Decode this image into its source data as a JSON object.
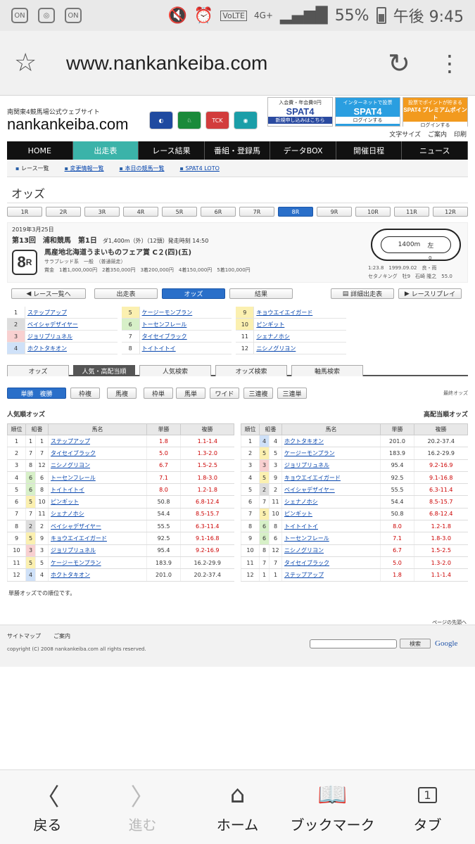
{
  "status": {
    "carrier_icons": [
      "ON",
      "ON"
    ],
    "network": "4G+",
    "battery": "55%",
    "time": "午後 9:45",
    "volte": "VoLTE"
  },
  "browser": {
    "url": "www.nankankeiba.com"
  },
  "site": {
    "subtitle": "南関東4競馬場公式ウェブサイト",
    "logo": "nankankeiba.com",
    "spat_banners": [
      {
        "top": "入会費・年会費0円",
        "big": "SPAT4",
        "foot": "新規申し込みはこちら"
      },
      {
        "top": "インターネットで投票",
        "big": "SPAT4",
        "foot": "ログインする"
      },
      {
        "top": "投票でポイントが貯まる",
        "big": "SPAT4 プレミアムポイント",
        "foot": "ログインする"
      }
    ],
    "utility": [
      "文字サイズ",
      "ご案内",
      "印刷"
    ],
    "nav": [
      "HOME",
      "出走表",
      "レース結果",
      "番組・登録馬",
      "データBOX",
      "開催日程",
      "ニュース"
    ],
    "subnav": [
      "レース一覧",
      "変更情報一覧",
      "本日の競馬一覧",
      "SPAT4 LOTO"
    ]
  },
  "page_title": "オッズ",
  "races": [
    "1R",
    "2R",
    "3R",
    "4R",
    "5R",
    "6R",
    "7R",
    "8R",
    "9R",
    "10R",
    "11R",
    "12R"
  ],
  "race": {
    "date": "2019年3月25日",
    "meeting": "第13回　浦和競馬　第1日",
    "course": "ダ1,400m（外）（12頭）発走時刻 14:50",
    "number": "8",
    "suffix": "R",
    "name": "馬産地北海道うまいものフェア賞 C２(四)(五)",
    "conditions": "サラブレッド系　一般　（普通競走）",
    "prize": "賞金　1着1,000,000円　2着350,000円　3着200,000円　4着150,000円　5着100,000円",
    "track_label": "1400m",
    "track_dir": "左",
    "track_zero": "0",
    "record_line1": "1:23.8　1999.09.02　良・雨",
    "record_line2": "セタノキング　牡9　石崎 隆之　55.0"
  },
  "pills": [
    "レース一覧へ",
    "出走表",
    "オッズ",
    "結果",
    "詳細出走表",
    "レースリプレイ"
  ],
  "entries": [
    {
      "n": "1",
      "name": "ステップアップ"
    },
    {
      "n": "2",
      "name": "ベイシャデザイヤー"
    },
    {
      "n": "3",
      "name": "ジョリプリュネル"
    },
    {
      "n": "4",
      "name": "ホクトタキオン"
    },
    {
      "n": "5",
      "name": "ケージーモンプラン"
    },
    {
      "n": "6",
      "name": "トーセンフレール"
    },
    {
      "n": "7",
      "name": "タイセイブラック"
    },
    {
      "n": "8",
      "name": "トイトイトイ"
    },
    {
      "n": "9",
      "name": "キョウエイエイガード"
    },
    {
      "n": "10",
      "name": "ピンギット"
    },
    {
      "n": "11",
      "name": "シェナノホシ"
    },
    {
      "n": "12",
      "name": "ニシノグリヨン"
    }
  ],
  "tabs": [
    "オッズ",
    "人気・高配当順",
    "人気検索",
    "オッズ検索",
    "軸馬検索"
  ],
  "bet_types": [
    "単勝　複勝",
    "枠複",
    "馬複",
    "枠単",
    "馬単",
    "ワイド",
    "三連複",
    "三連単"
  ],
  "latest_label": "最終オッズ",
  "left_title": "人気順オッズ",
  "right_title": "高配当順オッズ",
  "table_headers": [
    "順位",
    "組番",
    "馬名",
    "単勝",
    "複勝"
  ],
  "popular": [
    {
      "rank": "1",
      "waku": "1",
      "no": "1",
      "name": "ステップアップ",
      "win": "1.8",
      "place": "1.1-1.4"
    },
    {
      "rank": "2",
      "waku": "7",
      "no": "7",
      "name": "タイセイブラック",
      "win": "5.0",
      "place": "1.3-2.0"
    },
    {
      "rank": "3",
      "waku": "8",
      "no": "12",
      "name": "ニシノグリヨン",
      "win": "6.7",
      "place": "1.5-2.5"
    },
    {
      "rank": "4",
      "waku": "6",
      "no": "6",
      "name": "トーセンフレール",
      "win": "7.1",
      "place": "1.8-3.0"
    },
    {
      "rank": "5",
      "waku": "6",
      "no": "8",
      "name": "トイトイトイ",
      "win": "8.0",
      "place": "1.2-1.8"
    },
    {
      "rank": "6",
      "waku": "5",
      "no": "10",
      "name": "ピンギット",
      "win": "50.8",
      "place": "6.8-12.4"
    },
    {
      "rank": "7",
      "waku": "7",
      "no": "11",
      "name": "シェナノホシ",
      "win": "54.4",
      "place": "8.5-15.7"
    },
    {
      "rank": "8",
      "waku": "2",
      "no": "2",
      "name": "ベイシャデザイヤー",
      "win": "55.5",
      "place": "6.3-11.4"
    },
    {
      "rank": "9",
      "waku": "5",
      "no": "9",
      "name": "キョウエイエイガード",
      "win": "92.5",
      "place": "9.1-16.8"
    },
    {
      "rank": "10",
      "waku": "3",
      "no": "3",
      "name": "ジョリプリュネル",
      "win": "95.4",
      "place": "9.2-16.9"
    },
    {
      "rank": "11",
      "waku": "5",
      "no": "5",
      "name": "ケージーモンプラン",
      "win": "183.9",
      "place": "16.2-29.9"
    },
    {
      "rank": "12",
      "waku": "4",
      "no": "4",
      "name": "ホクトタキオン",
      "win": "201.0",
      "place": "20.2-37.4"
    }
  ],
  "high_payout": [
    {
      "rank": "1",
      "waku": "4",
      "no": "4",
      "name": "ホクトタキオン",
      "win": "201.0",
      "place": "20.2-37.4"
    },
    {
      "rank": "2",
      "waku": "5",
      "no": "5",
      "name": "ケージーモンプラン",
      "win": "183.9",
      "place": "16.2-29.9"
    },
    {
      "rank": "3",
      "waku": "3",
      "no": "3",
      "name": "ジョリプリュネル",
      "win": "95.4",
      "place": "9.2-16.9"
    },
    {
      "rank": "4",
      "waku": "5",
      "no": "9",
      "name": "キョウエイエイガード",
      "win": "92.5",
      "place": "9.1-16.8"
    },
    {
      "rank": "5",
      "waku": "2",
      "no": "2",
      "name": "ベイシャデザイヤー",
      "win": "55.5",
      "place": "6.3-11.4"
    },
    {
      "rank": "6",
      "waku": "7",
      "no": "11",
      "name": "シェナノホシ",
      "win": "54.4",
      "place": "8.5-15.7"
    },
    {
      "rank": "7",
      "waku": "5",
      "no": "10",
      "name": "ピンギット",
      "win": "50.8",
      "place": "6.8-12.4"
    },
    {
      "rank": "8",
      "waku": "6",
      "no": "8",
      "name": "トイトイトイ",
      "win": "8.0",
      "place": "1.2-1.8"
    },
    {
      "rank": "9",
      "waku": "6",
      "no": "6",
      "name": "トーセンフレール",
      "win": "7.1",
      "place": "1.8-3.0"
    },
    {
      "rank": "10",
      "waku": "8",
      "no": "12",
      "name": "ニシノグリヨン",
      "win": "6.7",
      "place": "1.5-2.5"
    },
    {
      "rank": "11",
      "waku": "7",
      "no": "7",
      "name": "タイセイブラック",
      "win": "5.0",
      "place": "1.3-2.0"
    },
    {
      "rank": "12",
      "waku": "1",
      "no": "1",
      "name": "ステップアップ",
      "win": "1.8",
      "place": "1.1-1.4"
    }
  ],
  "note": "単勝オッズでの順位です。",
  "to_top": "ページの先頭へ",
  "footer": {
    "links": [
      "サイトマップ",
      "ご案内"
    ],
    "copyright": "copyright (C) 2008 nankankeiba.com all rights reserved.",
    "search_button": "検索",
    "google": "Google"
  },
  "bottom_nav": [
    {
      "label": "戻る",
      "icon": "chevron-left-icon",
      "disabled": false
    },
    {
      "label": "進む",
      "icon": "chevron-right-icon",
      "disabled": true
    },
    {
      "label": "ホーム",
      "icon": "home-icon",
      "disabled": false
    },
    {
      "label": "ブックマーク",
      "icon": "bookmark-book-icon",
      "disabled": false
    },
    {
      "label": "タブ",
      "icon": "tabs-icon",
      "disabled": false,
      "count": "1"
    }
  ]
}
